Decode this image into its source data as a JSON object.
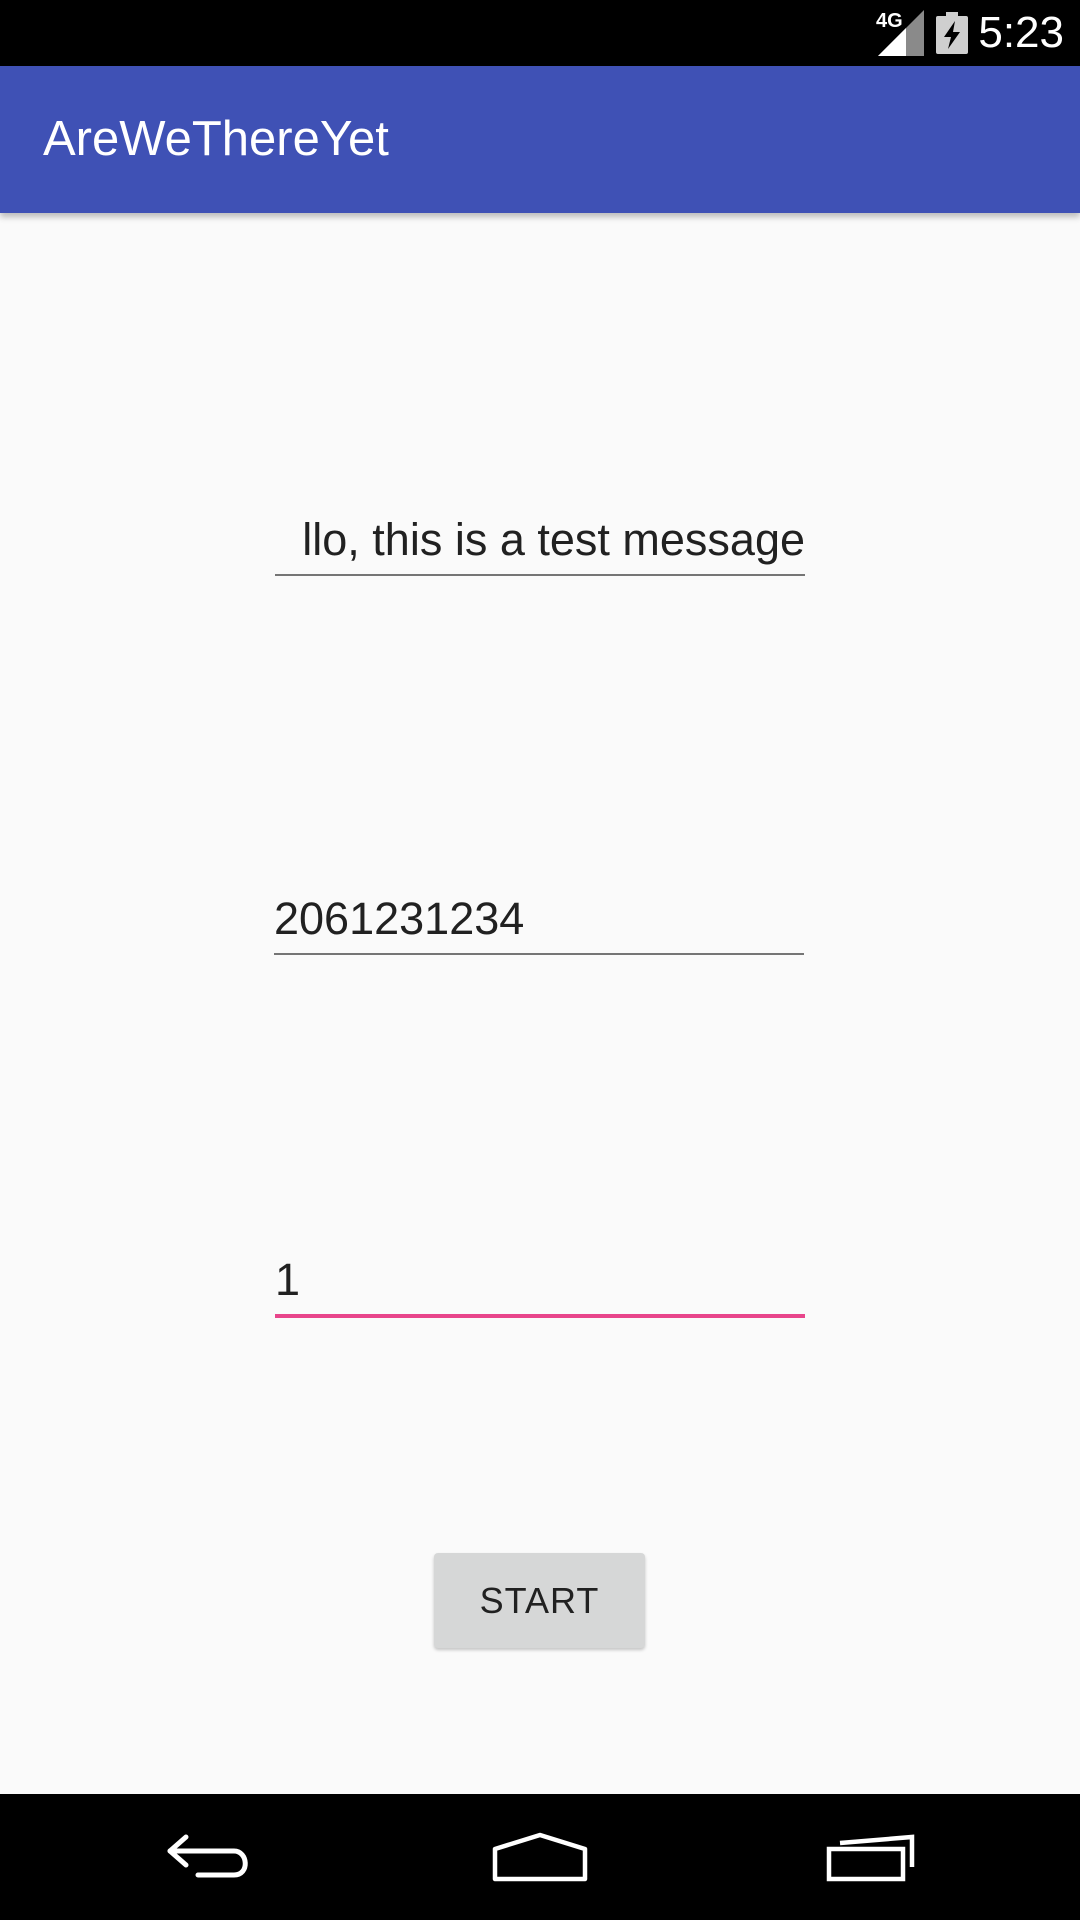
{
  "status_bar": {
    "time": "5:23",
    "network_type": "4G",
    "icons": [
      "signal-icon",
      "battery-charging-icon"
    ]
  },
  "app_bar": {
    "title": "AreWeThereYet",
    "background_color": "#3f51b5"
  },
  "form": {
    "message_value": "llo, this is a test message",
    "phone_value": "2061231234",
    "interval_value": "1",
    "focused_field": "interval",
    "focus_color": "#e8458b"
  },
  "start_button": {
    "label": "START"
  },
  "nav_bar": {
    "icons": [
      "back-icon",
      "home-icon",
      "recents-icon"
    ]
  }
}
